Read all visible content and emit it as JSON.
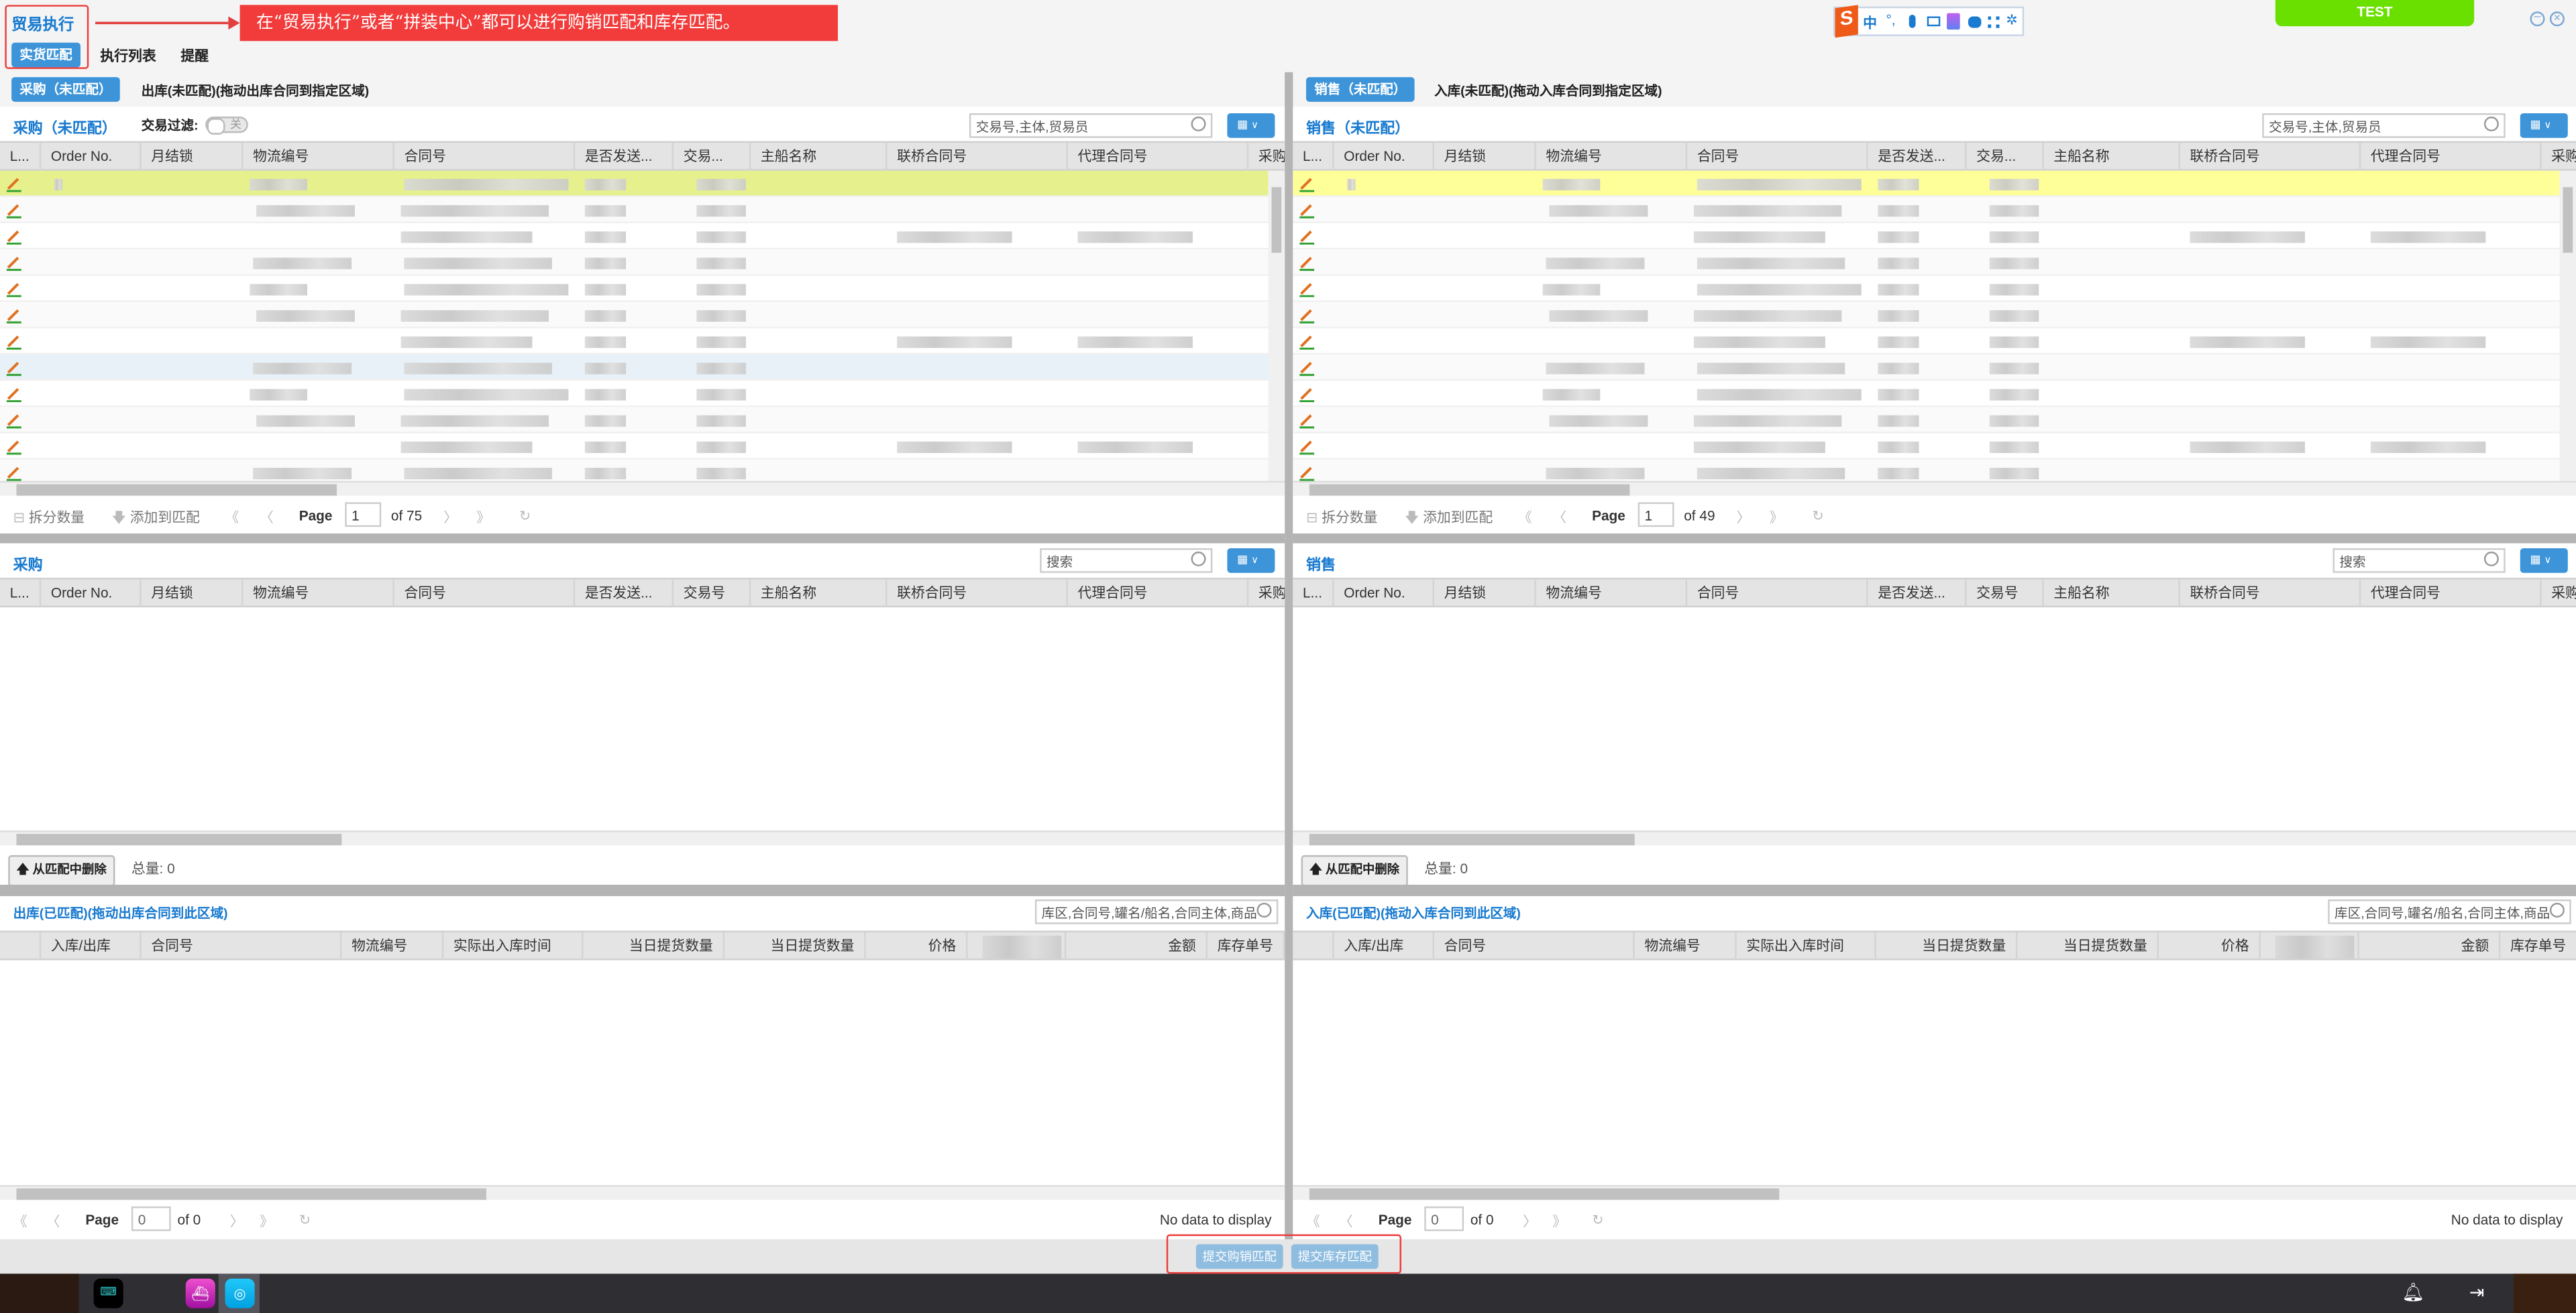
{
  "app": {
    "title": "贸易执行",
    "tabs": [
      "实货匹配",
      "执行列表",
      "提醒"
    ],
    "active_tab": 0,
    "annotation": "在“贸易执行”或者“拼装中心”都可以进行购销匹配和库存匹配。",
    "env_badge": "TEST",
    "ime_toolbar": [
      "中",
      "°,",
      "mic-icon",
      "keyboard-icon",
      "skin-icon",
      "game-icon",
      "apps-icon",
      "settings-icon"
    ]
  },
  "colors": {
    "accent": "#3d94d8",
    "annotation": "#f23c3c",
    "env_badge": "#6ae000",
    "selected_row_left": "#e6f08c",
    "selected_row_right": "#ffff99",
    "hover_row": "#e8f1f8"
  },
  "left": {
    "strip": {
      "tab": "采购（未匹配）",
      "tab2": "出库(未匹配)(拖动出库合同到指定区域)"
    },
    "grid1": {
      "title": "采购（未匹配）",
      "filter_label": "交易过滤:",
      "filter_state": "关",
      "search_placeholder": "交易号,主体,贸易员",
      "columns": [
        "L...",
        "Order No.",
        "月结锁",
        "物流编号",
        "合同号",
        "是否发送...",
        "交易...",
        "主船名称",
        "联桥合同号",
        "代理合同号",
        "采购"
      ],
      "rows": [
        "selected",
        "",
        "",
        "",
        "",
        "",
        "",
        "hover",
        "",
        "",
        "",
        ""
      ],
      "pager": {
        "split": "拆分数量",
        "add": "添加到匹配",
        "page_label": "Page",
        "page": "1",
        "of": "of 75"
      }
    },
    "grid2": {
      "title": "采购",
      "search_placeholder": "搜索",
      "columns": [
        "L...",
        "Order No.",
        "月结锁",
        "物流编号",
        "合同号",
        "是否发送...",
        "交易号",
        "主船名称",
        "联桥合同号",
        "代理合同号",
        "采购"
      ],
      "remove": "从匹配中删除",
      "total": "总量: 0"
    },
    "grid3": {
      "title": "出库(已匹配)(拖动出库合同到此区域)",
      "search_placeholder": "库区,合同号,罐名/船名,合同主体,商品",
      "columns": [
        "",
        "入库/出库",
        "合同号",
        "物流编号",
        "实际出入库时间",
        "当日提货数量",
        "当日提货数量",
        "价格",
        "",
        "金额",
        "库存单号"
      ],
      "pager": {
        "page_label": "Page",
        "page": "0",
        "of": "of 0",
        "empty": "No data to display"
      }
    }
  },
  "right": {
    "strip": {
      "tab": "销售（未匹配）",
      "tab2": "入库(未匹配)(拖动入库合同到指定区域)"
    },
    "grid1": {
      "title": "销售（未匹配）",
      "search_placeholder": "交易号,主体,贸易员",
      "columns": [
        "L...",
        "Order No.",
        "月结锁",
        "物流编号",
        "合同号",
        "是否发送...",
        "交易...",
        "主船名称",
        "联桥合同号",
        "代理合同号",
        "采购"
      ],
      "rows": [
        "selected",
        "",
        "",
        "",
        "",
        "",
        "",
        "",
        "",
        "",
        "",
        ""
      ],
      "pager": {
        "split": "拆分数量",
        "add": "添加到匹配",
        "page_label": "Page",
        "page": "1",
        "of": "of 49"
      }
    },
    "grid2": {
      "title": "销售",
      "search_placeholder": "搜索",
      "columns": [
        "L...",
        "Order No.",
        "月结锁",
        "物流编号",
        "合同号",
        "是否发送...",
        "交易号",
        "主船名称",
        "联桥合同号",
        "代理合同号",
        "采购"
      ],
      "remove": "从匹配中删除",
      "total": "总量: 0"
    },
    "grid3": {
      "title": "入库(已匹配)(拖动入库合同到此区域)",
      "search_placeholder": "库区,合同号,罐名/船名,合同主体,商品",
      "columns": [
        "",
        "入库/出库",
        "合同号",
        "物流编号",
        "实际出入库时间",
        "当日提货数量",
        "当日提货数量",
        "价格",
        "",
        "金额",
        "库存单号"
      ],
      "pager": {
        "page_label": "Page",
        "page": "0",
        "of": "of 0",
        "empty": "No data to display"
      }
    }
  },
  "footer": {
    "submit_trade": "提交购销匹配",
    "submit_stock": "提交库存匹配"
  }
}
